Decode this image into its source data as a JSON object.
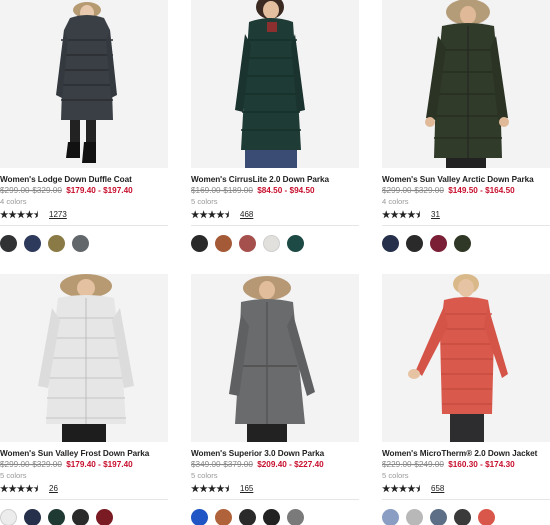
{
  "products": [
    {
      "title": "Women's Lodge Down Duffle Coat",
      "original_price": "$299.00-$329.00",
      "sale_price": "$179.40 - $197.40",
      "colors_label": "4 colors",
      "rating": 4.5,
      "review_count": "1273",
      "swatches": [
        "#303234",
        "#2e3a5c",
        "#8a7a45",
        "#62676b"
      ]
    },
    {
      "title": "Women's CirrusLite 2.0 Down Parka",
      "original_price": "$169.00-$189.00",
      "sale_price": "$84.50 - $94.50",
      "colors_label": "5 colors",
      "rating": 4.5,
      "review_count": "468",
      "swatches": [
        "#2a2a2a",
        "#a45a36",
        "#a6504d",
        "#e2e0dc",
        "#1d4a44"
      ]
    },
    {
      "title": "Women's Sun Valley Arctic Down Parka",
      "original_price": "$299.00-$329.00",
      "sale_price": "$149.50 - $164.50",
      "colors_label": "4 colors",
      "rating": 4.5,
      "review_count": "31",
      "swatches": [
        "#26304a",
        "#2a2a2a",
        "#7a1f35",
        "#2f3826"
      ]
    },
    {
      "title": "Women's Sun Valley Frost Down Parka",
      "original_price": "$299.00-$329.00",
      "sale_price": "$179.40 - $197.40",
      "colors_label": "5 colors",
      "rating": 4.5,
      "review_count": "26",
      "swatches": [
        "#ececec",
        "#26304a",
        "#1f3a32",
        "#2a2a2a",
        "#7a1a22"
      ]
    },
    {
      "title": "Women's Superior 3.0 Down Parka",
      "original_price": "$349.00-$379.00",
      "sale_price": "$209.40 - $227.40",
      "colors_label": "5 colors",
      "rating": 4.5,
      "review_count": "165",
      "swatches": [
        "#1f55c4",
        "#b0623a",
        "#2a2a2a",
        "#222222",
        "#7a7a7a"
      ]
    },
    {
      "title": "Women's MicroTherm® 2.0 Down Jacket",
      "original_price": "$229.00-$249.00",
      "sale_price": "$160.30 - $174.30",
      "colors_label": "5 colors",
      "rating": 4.5,
      "review_count": "658",
      "swatches": [
        "#8a9ec4",
        "#b8b8b8",
        "#5c6f86",
        "#3a3a3a",
        "#d8574a"
      ]
    }
  ]
}
